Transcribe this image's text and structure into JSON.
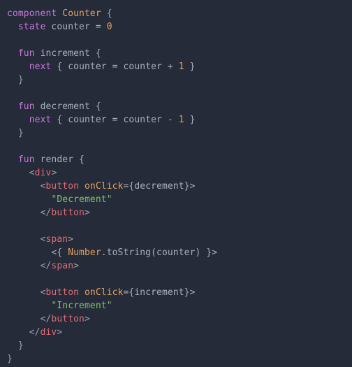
{
  "editor": {
    "name": "code-editor",
    "language": "jsx-component-dsl",
    "background_color": "#252b38",
    "font_size_px": 13,
    "line_height_px": 19,
    "colors": {
      "keyword": "#c678dd",
      "type": "#e0a264",
      "number": "#e5a06a",
      "plain": "#a8b0bf",
      "punctuation": "#9aa2b1",
      "tag": "#e06c75",
      "attribute": "#e0a264",
      "string": "#81c06a"
    }
  },
  "code": {
    "lines": [
      {
        "n": 1,
        "tokens": [
          {
            "t": "component",
            "c": "kw"
          },
          {
            "t": " ",
            "c": "plain"
          },
          {
            "t": "Counter",
            "c": "type"
          },
          {
            "t": " {",
            "c": "punc"
          }
        ]
      },
      {
        "n": 2,
        "tokens": [
          {
            "t": "  ",
            "c": "plain"
          },
          {
            "t": "state",
            "c": "kw"
          },
          {
            "t": " counter = ",
            "c": "plain"
          },
          {
            "t": "0",
            "c": "num"
          }
        ]
      },
      {
        "n": 3,
        "tokens": []
      },
      {
        "n": 4,
        "tokens": [
          {
            "t": "  ",
            "c": "plain"
          },
          {
            "t": "fun",
            "c": "kw"
          },
          {
            "t": " increment {",
            "c": "plain"
          }
        ]
      },
      {
        "n": 5,
        "tokens": [
          {
            "t": "    ",
            "c": "plain"
          },
          {
            "t": "next",
            "c": "kw"
          },
          {
            "t": " { counter = counter + ",
            "c": "plain"
          },
          {
            "t": "1",
            "c": "num"
          },
          {
            "t": " }",
            "c": "plain"
          }
        ]
      },
      {
        "n": 6,
        "tokens": [
          {
            "t": "  }",
            "c": "punc"
          }
        ]
      },
      {
        "n": 7,
        "tokens": []
      },
      {
        "n": 8,
        "tokens": [
          {
            "t": "  ",
            "c": "plain"
          },
          {
            "t": "fun",
            "c": "kw"
          },
          {
            "t": " decrement {",
            "c": "plain"
          }
        ]
      },
      {
        "n": 9,
        "tokens": [
          {
            "t": "    ",
            "c": "plain"
          },
          {
            "t": "next",
            "c": "kw"
          },
          {
            "t": " { counter = counter - ",
            "c": "plain"
          },
          {
            "t": "1",
            "c": "num"
          },
          {
            "t": " }",
            "c": "plain"
          }
        ]
      },
      {
        "n": 10,
        "tokens": [
          {
            "t": "  }",
            "c": "punc"
          }
        ]
      },
      {
        "n": 11,
        "tokens": []
      },
      {
        "n": 12,
        "tokens": [
          {
            "t": "  ",
            "c": "plain"
          },
          {
            "t": "fun",
            "c": "kw"
          },
          {
            "t": " render {",
            "c": "plain"
          }
        ]
      },
      {
        "n": 13,
        "tokens": [
          {
            "t": "    ",
            "c": "plain"
          },
          {
            "t": "<",
            "c": "bracket"
          },
          {
            "t": "div",
            "c": "tag"
          },
          {
            "t": ">",
            "c": "bracket"
          }
        ]
      },
      {
        "n": 14,
        "tokens": [
          {
            "t": "      ",
            "c": "plain"
          },
          {
            "t": "<",
            "c": "bracket"
          },
          {
            "t": "button",
            "c": "tag"
          },
          {
            "t": " ",
            "c": "plain"
          },
          {
            "t": "onClick",
            "c": "attr"
          },
          {
            "t": "={decrement}>",
            "c": "plain"
          }
        ]
      },
      {
        "n": 15,
        "tokens": [
          {
            "t": "        ",
            "c": "plain"
          },
          {
            "t": "\"Decrement\"",
            "c": "string"
          }
        ]
      },
      {
        "n": 16,
        "tokens": [
          {
            "t": "      ",
            "c": "plain"
          },
          {
            "t": "</",
            "c": "bracket"
          },
          {
            "t": "button",
            "c": "tag"
          },
          {
            "t": ">",
            "c": "bracket"
          }
        ]
      },
      {
        "n": 17,
        "tokens": []
      },
      {
        "n": 18,
        "tokens": [
          {
            "t": "      ",
            "c": "plain"
          },
          {
            "t": "<",
            "c": "bracket"
          },
          {
            "t": "span",
            "c": "tag"
          },
          {
            "t": ">",
            "c": "bracket"
          }
        ]
      },
      {
        "n": 19,
        "tokens": [
          {
            "t": "        <{ ",
            "c": "plain"
          },
          {
            "t": "Number",
            "c": "type"
          },
          {
            "t": ".toString(counter) }>",
            "c": "plain"
          }
        ]
      },
      {
        "n": 20,
        "tokens": [
          {
            "t": "      ",
            "c": "plain"
          },
          {
            "t": "</",
            "c": "bracket"
          },
          {
            "t": "span",
            "c": "tag"
          },
          {
            "t": ">",
            "c": "bracket"
          }
        ]
      },
      {
        "n": 21,
        "tokens": []
      },
      {
        "n": 22,
        "tokens": [
          {
            "t": "      ",
            "c": "plain"
          },
          {
            "t": "<",
            "c": "bracket"
          },
          {
            "t": "button",
            "c": "tag"
          },
          {
            "t": " ",
            "c": "plain"
          },
          {
            "t": "onClick",
            "c": "attr"
          },
          {
            "t": "={increment}>",
            "c": "plain"
          }
        ]
      },
      {
        "n": 23,
        "tokens": [
          {
            "t": "        ",
            "c": "plain"
          },
          {
            "t": "\"Increment\"",
            "c": "string"
          }
        ]
      },
      {
        "n": 24,
        "tokens": [
          {
            "t": "      ",
            "c": "plain"
          },
          {
            "t": "</",
            "c": "bracket"
          },
          {
            "t": "button",
            "c": "tag"
          },
          {
            "t": ">",
            "c": "bracket"
          }
        ]
      },
      {
        "n": 25,
        "tokens": [
          {
            "t": "    ",
            "c": "plain"
          },
          {
            "t": "</",
            "c": "bracket"
          },
          {
            "t": "div",
            "c": "tag"
          },
          {
            "t": ">",
            "c": "bracket"
          }
        ]
      },
      {
        "n": 26,
        "tokens": [
          {
            "t": "  }",
            "c": "punc"
          }
        ]
      },
      {
        "n": 27,
        "tokens": [
          {
            "t": "}",
            "c": "punc"
          }
        ]
      }
    ]
  }
}
